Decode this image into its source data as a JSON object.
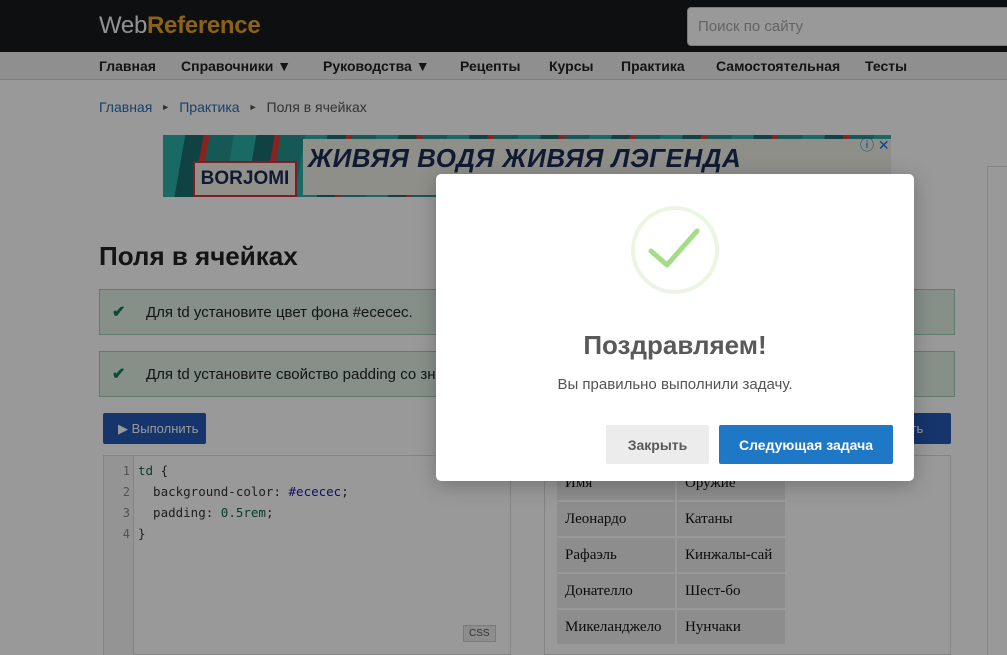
{
  "header": {
    "logo_part1": "Web",
    "logo_part2": "Reference",
    "search_placeholder": "Поиск по сайту"
  },
  "nav": {
    "items": [
      "Главная",
      "Справочники ▼",
      "Руководства ▼",
      "Рецепты",
      "Курсы",
      "Практика",
      "Самостоятельная",
      "Тесты"
    ]
  },
  "breadcrumb": {
    "home": "Главная",
    "section": "Практика",
    "current": "Поля в ячейках",
    "separator": "►"
  },
  "ad": {
    "brand": "BORJOMI",
    "headline": "ЖИВЯЯ ВОДЯ ЖИВЯЯ ЛЭГЕНДА",
    "controls": "ⓘ ✕"
  },
  "page": {
    "title": "Поля в ячейках"
  },
  "tasks": [
    {
      "text": "Для td установите цвет фона #ececec.",
      "done": true
    },
    {
      "text": "Для td установите свойство padding со зн",
      "done": true
    }
  ],
  "editor": {
    "run_label": "▶ Выполнить",
    "run_label_right": "оить",
    "lang": "CSS",
    "line_numbers": [
      "1",
      "2",
      "3",
      "4"
    ],
    "lines": [
      {
        "sel": "td",
        "rest": " {"
      },
      {
        "prop": "  background-color",
        "val": "#ececec"
      },
      {
        "prop": "  padding",
        "val": "0.5rem"
      },
      {
        "sel": "}",
        "rest": ""
      }
    ]
  },
  "result_table": {
    "rows": [
      [
        "Имя",
        "Оружие"
      ],
      [
        "Леонардо",
        "Катаны"
      ],
      [
        "Рафаэль",
        "Кинжалы-сай"
      ],
      [
        "Донателло",
        "Шест-бо"
      ],
      [
        "Микеланджело",
        "Нунчаки"
      ]
    ]
  },
  "modal": {
    "title": "Поздравляем!",
    "text": "Вы правильно выполнили задачу.",
    "close_label": "Закрыть",
    "next_label": "Следующая задача"
  },
  "colors": {
    "accent": "#1e78c5",
    "success": "#a5dc86",
    "task_bg": "#dff0e4"
  }
}
